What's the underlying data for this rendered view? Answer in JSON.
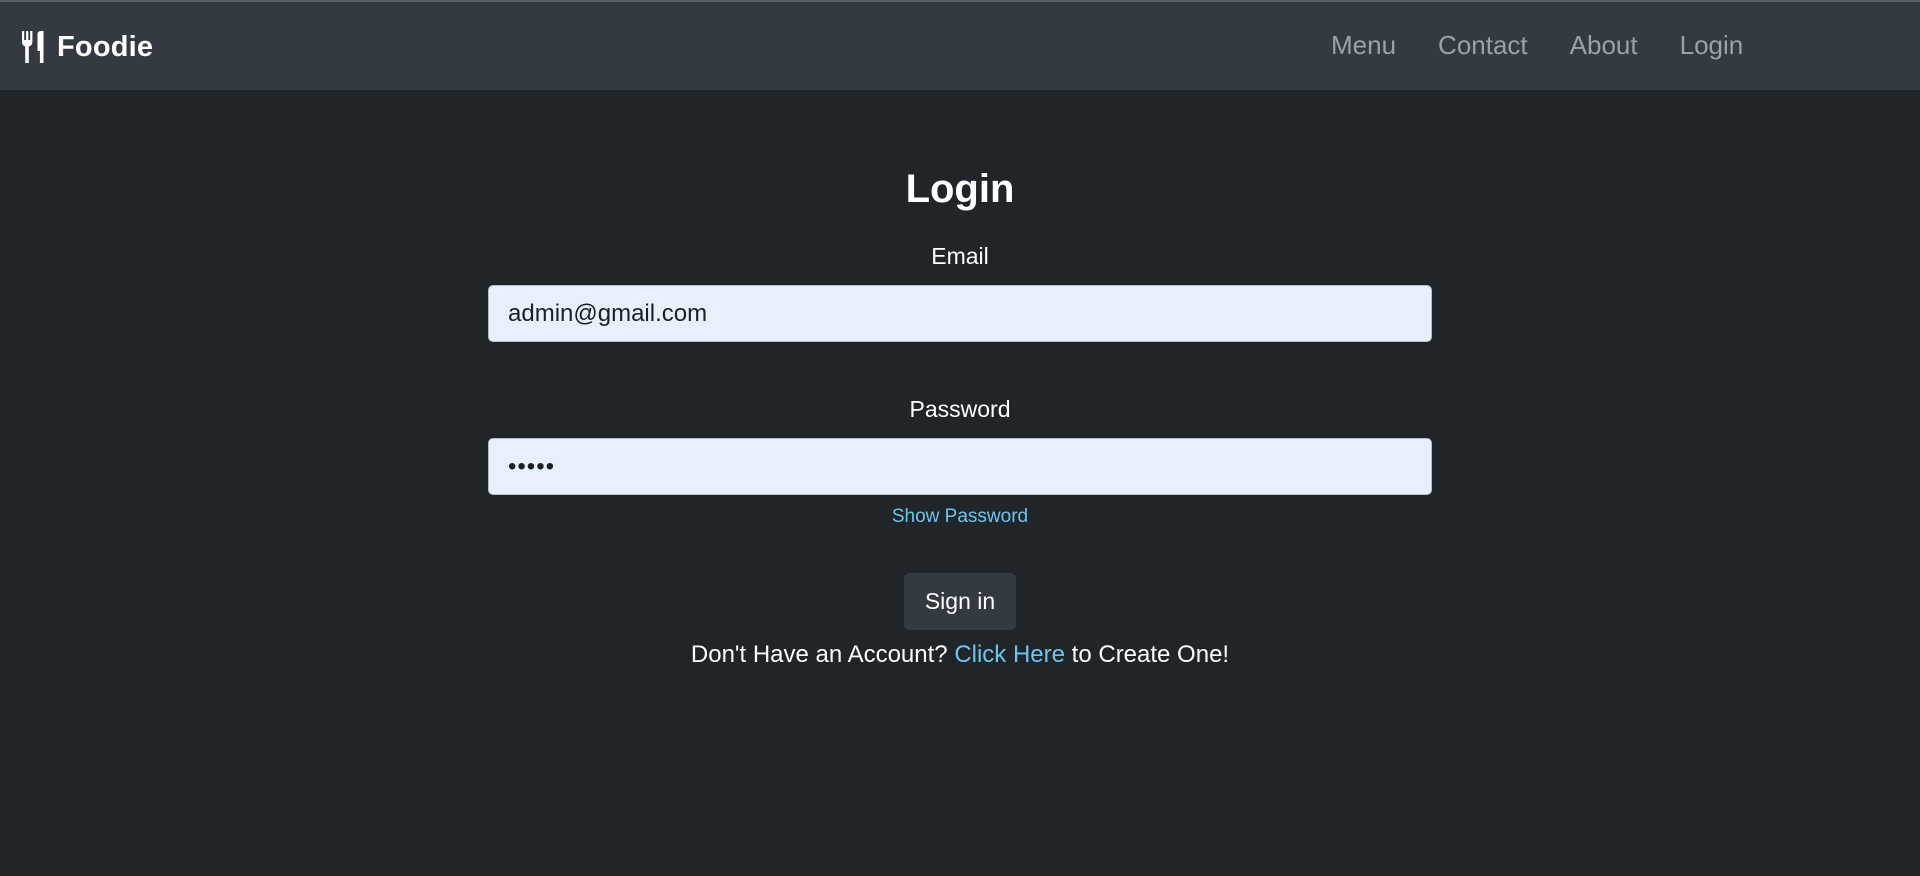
{
  "navbar": {
    "brand": "Foodie",
    "brand_icon": "utensils-icon",
    "links": [
      "Menu",
      "Contact",
      "About",
      "Login"
    ]
  },
  "login": {
    "title": "Login",
    "email_label": "Email",
    "email_value": "admin@gmail.com",
    "password_label": "Password",
    "password_value": "•••••",
    "show_password": "Show Password",
    "signin": "Sign in",
    "account_prefix": "Don't Have an Account?",
    "account_link": "Click Here",
    "account_suffix": "to Create One!"
  },
  "colors": {
    "page_bg": "#1f2529",
    "navbar_bg": "#343a42",
    "nav_link": "#9ba1a7",
    "input_bg": "#e8f0fe",
    "link": "#6fc4ee"
  }
}
